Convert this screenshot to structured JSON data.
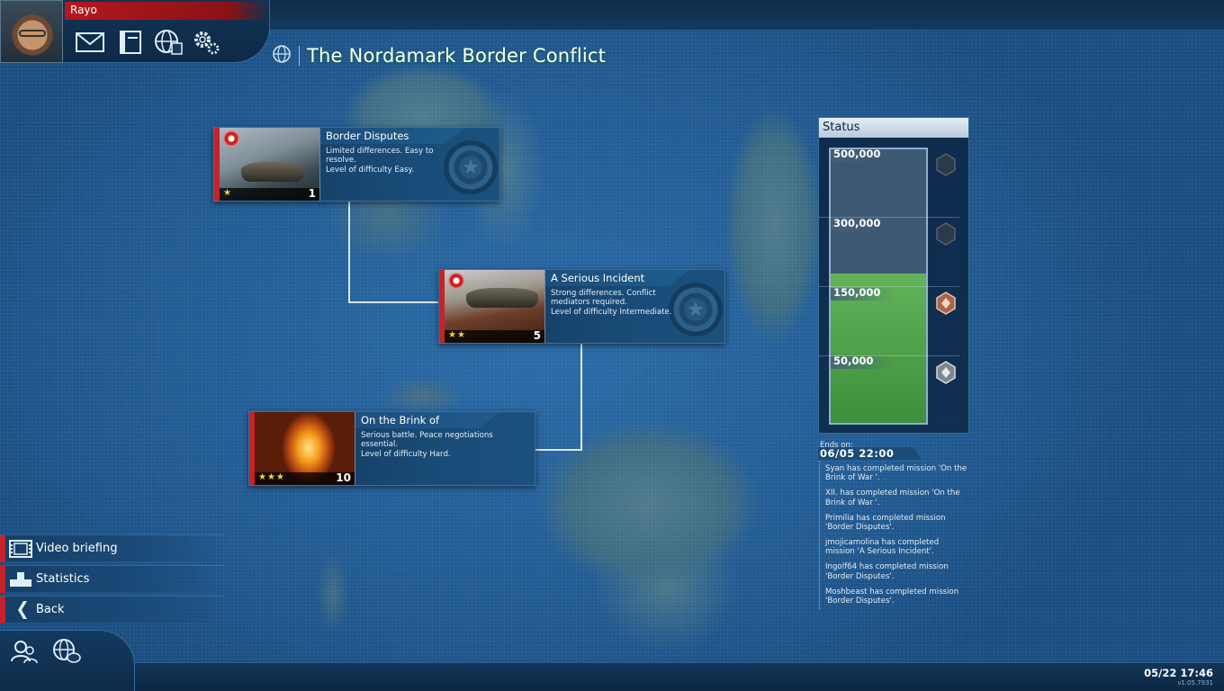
{
  "player": {
    "name": "Rayo"
  },
  "top_icons": [
    "mail-icon",
    "book-icon",
    "globe-news-icon",
    "gear-icon"
  ],
  "header": {
    "title": "The Nordamark Border Conflict"
  },
  "missions": [
    {
      "name": "Border Disputes",
      "description_line1": "Limited differences. Easy to resolve.",
      "description_line2": "Level of difficulty Easy.",
      "stars": "★",
      "count": "1"
    },
    {
      "name": "A Serious Incident",
      "description_line1": "Strong differences. Conflict mediators required.",
      "description_line2": "Level of difficulty Intermediate.",
      "stars": "★★",
      "count": "5"
    },
    {
      "name": "On the Brink of",
      "description_line1": "Serious battle. Peace negotiations essential.",
      "description_line2": "Level of difficulty Hard.",
      "stars": "★★★",
      "count": "10"
    }
  ],
  "status": {
    "title": "Status",
    "tiers": [
      {
        "label": "500,000",
        "reached": false
      },
      {
        "label": "300,000",
        "reached": false
      },
      {
        "label": "150,000",
        "reached": true
      },
      {
        "label": "50,000",
        "reached": true
      }
    ],
    "progress_fraction": 0.545,
    "ends_on_label": "Ends on:",
    "ends_on_value": "06/05 22:00"
  },
  "activity": [
    "Syan has completed mission 'On the Brink of War '.",
    "XII. has completed mission 'On the Brink of War '.",
    "Primilia has completed mission 'Border Disputes'.",
    "jmojicamolina has completed mission 'A Serious Incident'.",
    "Ingolf64 has completed mission 'Border Disputes'.",
    "Moshbeast has completed mission 'Border Disputes'."
  ],
  "side_menu": {
    "video_briefing": "Video briefing",
    "statistics": "Statistics",
    "back": "Back"
  },
  "bottom_icons": [
    "friends-icon",
    "world-chat-icon"
  ],
  "footer": {
    "clock": "05/22 17:46",
    "version": "v1.05.7931"
  },
  "colors": {
    "accent_red": "#c4232a",
    "progress_green": "#4fa14a",
    "panel_blue": "#133a5f"
  }
}
